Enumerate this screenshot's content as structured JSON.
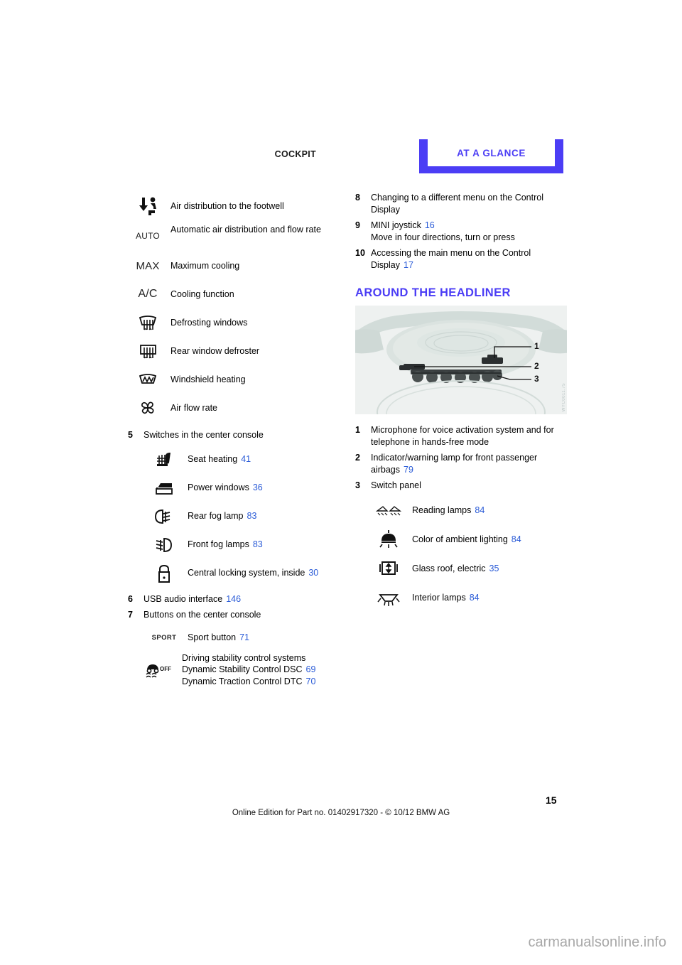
{
  "header": {
    "left_label": "COCKPIT",
    "tab_label": "AT A GLANCE",
    "accent_color": "#4b3df5"
  },
  "left_column": {
    "climate_icons": [
      {
        "icon": "air-distribution-footwell-icon",
        "label": "Air distribution to the footwell",
        "page": ""
      },
      {
        "icon": "auto-text-icon",
        "icon_text": "AUTO",
        "label": "Automatic air distribution and flow rate",
        "page": ""
      },
      {
        "icon": "max-text-icon",
        "icon_text": "MAX",
        "label": "Maximum cooling",
        "page": ""
      },
      {
        "icon": "ac-text-icon",
        "icon_text": "A/C",
        "label": "Cooling function",
        "page": ""
      },
      {
        "icon": "defrost-windshield-icon",
        "label": "Defrosting windows",
        "page": ""
      },
      {
        "icon": "rear-window-defroster-icon",
        "label": "Rear window defroster",
        "page": ""
      },
      {
        "icon": "windshield-heating-icon",
        "label": "Windshield heating",
        "page": ""
      },
      {
        "icon": "air-flow-rate-fan-icon",
        "label": "Air flow rate",
        "page": ""
      }
    ],
    "item5": {
      "number": "5",
      "text": "Switches in the center console",
      "sub_items": [
        {
          "icon": "seat-heating-icon",
          "label": "Seat heating",
          "page": "41"
        },
        {
          "icon": "power-windows-icon",
          "label": "Power windows",
          "page": "36"
        },
        {
          "icon": "rear-fog-lamp-icon",
          "label": "Rear fog lamp",
          "page": "83"
        },
        {
          "icon": "front-fog-lamps-icon",
          "label": "Front fog lamps",
          "page": "83"
        },
        {
          "icon": "central-locking-icon",
          "label": "Central locking system, inside",
          "page": "30"
        }
      ]
    },
    "item6": {
      "number": "6",
      "text": "USB audio interface",
      "page": "146"
    },
    "item7": {
      "number": "7",
      "text": "Buttons on the center console",
      "sub_items": [
        {
          "icon": "sport-text-icon",
          "icon_text": "SPORT",
          "label": "Sport button",
          "page": "71"
        }
      ],
      "dsc_block": {
        "icon": "dsc-off-icon",
        "title": "Driving stability control systems",
        "lines": [
          {
            "label": "Dynamic Stability Control DSC",
            "page": "69"
          },
          {
            "label": "Dynamic Traction Control DTC",
            "page": "70"
          }
        ]
      }
    }
  },
  "right_column": {
    "item8": {
      "number": "8",
      "text": "Changing to a different menu on the Control Display",
      "page": ""
    },
    "item9": {
      "number": "9",
      "text": "MINI joystick",
      "page": "16",
      "sub_text": "Move in four directions, turn or press"
    },
    "item10": {
      "number": "10",
      "text": "Accessing the main menu on the Control Display",
      "page": "17"
    },
    "section_title": "AROUND THE HEADLINER",
    "figure": {
      "name": "headliner-illustration",
      "watermark": "WYC0011.75",
      "callouts": [
        "1",
        "2",
        "3"
      ]
    },
    "item1": {
      "number": "1",
      "text": "Microphone for voice activation system and for telephone in hands-free mode",
      "page": ""
    },
    "item2": {
      "number": "2",
      "text": "Indicator/warning lamp for front passenger airbags",
      "page": "79"
    },
    "item3": {
      "number": "3",
      "text": "Switch panel",
      "sub_items": [
        {
          "icon": "reading-lamps-icon",
          "label": "Reading lamps",
          "page": "84"
        },
        {
          "icon": "ambient-lighting-color-icon",
          "label": "Color of ambient lighting",
          "page": "84"
        },
        {
          "icon": "glass-roof-electric-icon",
          "label": "Glass roof, electric",
          "page": "35"
        },
        {
          "icon": "interior-lamps-icon",
          "label": "Interior lamps",
          "page": "84"
        }
      ]
    }
  },
  "footer": {
    "page_number": "15",
    "note": "Online Edition for Part no. 01402917320 - © 10/12 BMW AG",
    "site_watermark": "carmanualsonline.info"
  }
}
